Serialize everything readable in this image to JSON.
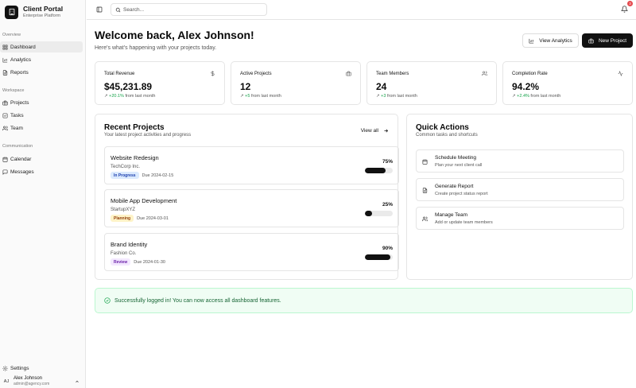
{
  "brand": {
    "title": "Client Portal",
    "subtitle": "Enterprise Platform"
  },
  "sidebar": {
    "sections": [
      "Overview",
      "Workspace",
      "Communication"
    ],
    "items": [
      {
        "label": "Dashboard",
        "icon": "home-icon",
        "active": true
      },
      {
        "label": "Analytics",
        "icon": "bar-chart-icon"
      },
      {
        "label": "Reports",
        "icon": "file-text-icon"
      },
      {
        "label": "Projects",
        "icon": "briefcase-icon"
      },
      {
        "label": "Tasks",
        "icon": "check-square-icon"
      },
      {
        "label": "Team",
        "icon": "users-icon"
      },
      {
        "label": "Calendar",
        "icon": "calendar-icon"
      },
      {
        "label": "Messages",
        "icon": "message-icon"
      }
    ],
    "settings_label": "Settings",
    "user": {
      "initials": "AJ",
      "name": "Alex Johnson",
      "email": "admin@agency.com"
    }
  },
  "topbar": {
    "search_placeholder": "Search...",
    "notification_count": "3"
  },
  "header": {
    "title": "Welcome back, Alex Johnson!",
    "subtitle": "Here's what's happening with your projects today.",
    "analytics_button": "View Analytics",
    "new_project_button": "New Project"
  },
  "stats": [
    {
      "title": "Total Revenue",
      "value": "$45,231.89",
      "change": "+20.1%",
      "suffix": "from last month",
      "icon": "dollar-icon"
    },
    {
      "title": "Active Projects",
      "value": "12",
      "change": "+5",
      "suffix": "from last month",
      "icon": "briefcase-icon"
    },
    {
      "title": "Team Members",
      "value": "24",
      "change": "+3",
      "suffix": "from last month",
      "icon": "users-icon"
    },
    {
      "title": "Completion Rate",
      "value": "94.2%",
      "change": "+2.4%",
      "suffix": "from last month",
      "icon": "activity-icon"
    }
  ],
  "recent_projects": {
    "title": "Recent Projects",
    "subtitle": "Your latest project activities and progress",
    "view_all": "View all",
    "projects": [
      {
        "name": "Website Redesign",
        "client": "TechCorp Inc.",
        "status": "In Progress",
        "status_color": "#dbeafe",
        "status_text_color": "#1e40af",
        "due": "Due 2024-02-15",
        "progress_label": "75%",
        "progress": 0.75
      },
      {
        "name": "Mobile App Development",
        "client": "StartupXYZ",
        "status": "Planning",
        "status_color": "#fef3c7",
        "status_text_color": "#92400e",
        "due": "Due 2024-03-01",
        "progress_label": "25%",
        "progress": 0.25
      },
      {
        "name": "Brand Identity",
        "client": "Fashion Co.",
        "status": "Review",
        "status_color": "#f3e8ff",
        "status_text_color": "#6b21a8",
        "due": "Due 2024-01-30",
        "progress_label": "90%",
        "progress": 0.9
      }
    ]
  },
  "quick_actions": {
    "title": "Quick Actions",
    "subtitle": "Common tasks and shortcuts",
    "items": [
      {
        "title": "Schedule Meeting",
        "subtitle": "Plan your next client call",
        "icon": "calendar-icon"
      },
      {
        "title": "Generate Report",
        "subtitle": "Create project status report",
        "icon": "file-text-icon"
      },
      {
        "title": "Manage Team",
        "subtitle": "Add or update team members",
        "icon": "users-icon"
      }
    ]
  },
  "alert": {
    "message": "Successfully logged in! You can now access all dashboard features."
  },
  "colors": {
    "accent": "#111111",
    "success": "#16a34a",
    "badge": "#e5484d"
  }
}
